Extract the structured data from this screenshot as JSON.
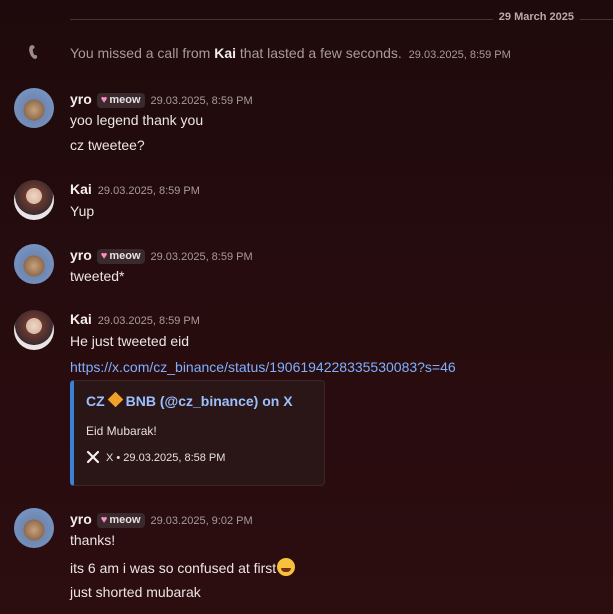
{
  "divider": {
    "date": "29 March 2025"
  },
  "call": {
    "prefix": "You missed a call from ",
    "caller": "Kai",
    "suffix": " that lasted a few seconds.",
    "timestamp": "29.03.2025, 8:59 PM"
  },
  "messages": [
    {
      "author": "yro",
      "tag": "meow",
      "timestamp": "29.03.2025, 8:59 PM",
      "lines": [
        "yoo legend thank you",
        "cz tweetee?"
      ]
    },
    {
      "author": "Kai",
      "timestamp": "29.03.2025, 8:59 PM",
      "lines": [
        "Yup"
      ]
    },
    {
      "author": "yro",
      "tag": "meow",
      "timestamp": "29.03.2025, 8:59 PM",
      "lines": [
        "tweeted*"
      ]
    },
    {
      "author": "Kai",
      "timestamp": "29.03.2025, 8:59 PM",
      "lines": [
        "He just tweeted eid",
        "https://x.com/cz_binance/status/1906194228335530083?s=46"
      ],
      "embed": {
        "title_pre": "CZ",
        "title_post": "BNB (@cz_binance) on X",
        "description": "Eid Mubarak!",
        "footer": "X • 29.03.2025, 8:58 PM"
      }
    },
    {
      "author": "yro",
      "tag": "meow",
      "timestamp": "29.03.2025, 9:02 PM",
      "lines": [
        "thanks!",
        "its 6 am i was so confused at first",
        "just shorted mubarak"
      ]
    }
  ],
  "colors": {
    "link": "#7fb0ff",
    "embed_accent": "#3b82d6",
    "background": "#260c0e"
  },
  "icons": {
    "call": "phone-missed-icon",
    "embed_source": "x-logo-icon",
    "emoji": "rofl-emoji"
  }
}
